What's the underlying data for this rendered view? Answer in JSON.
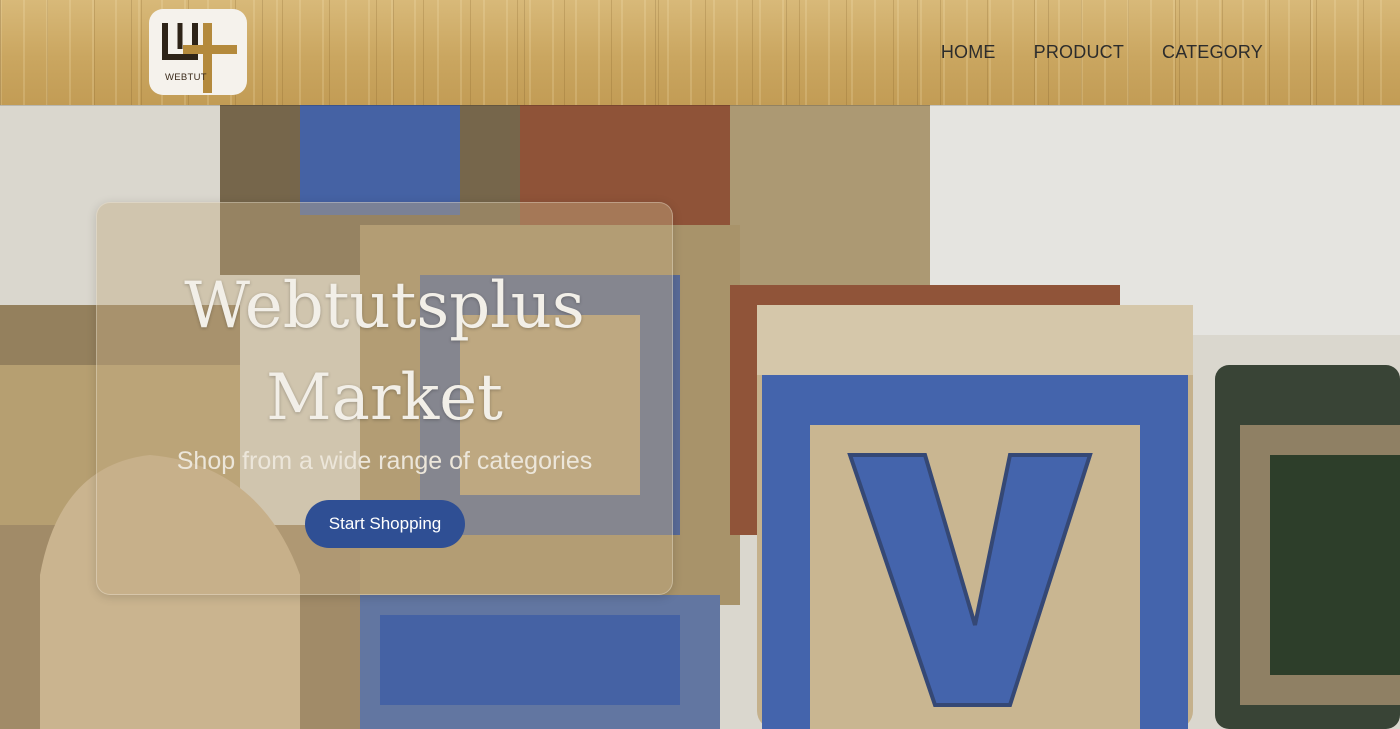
{
  "header": {
    "logo_text": "WEBTUT",
    "nav": [
      {
        "label": "HOME"
      },
      {
        "label": "PRODUCT"
      },
      {
        "label": "CATEGORY"
      }
    ]
  },
  "hero": {
    "title_line1": "Webtutsplus",
    "title_line2": "Market",
    "subtitle": "Shop from a wide range of categories",
    "button_label": "Start Shopping",
    "background_letters": [
      "V"
    ]
  },
  "colors": {
    "header_wood": "#cfae6a",
    "button_bg": "#2f4f94",
    "button_text": "#ffffff",
    "title_text": "#f2efe8",
    "nav_text": "#2c2c2c",
    "logo_accent": "#b48a3c"
  },
  "icons": [
    "logo-mark-icon"
  ]
}
